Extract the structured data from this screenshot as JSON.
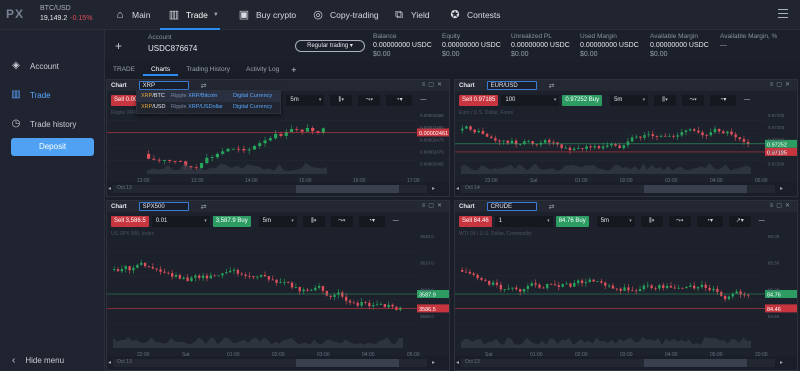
{
  "brand": {
    "logo": "PX"
  },
  "ticker": {
    "pair": "BTC/USD",
    "price": "19,149.2",
    "change": "-0.15%"
  },
  "nav": {
    "main": "Main",
    "trade": "Trade",
    "buy_crypto": "Buy crypto",
    "copy_trading": "Copy-trading",
    "yield": "Yield",
    "contests": "Contests"
  },
  "sidebar": {
    "account": "Account",
    "trade": "Trade",
    "trade_history": "Trade history",
    "deposit": "Deposit",
    "hide_menu": "Hide menu"
  },
  "account": {
    "label": "Account",
    "id": "USDC876674",
    "mode": "Regular trading",
    "balance_label": "Balance",
    "balance": "0.00000000 USDC",
    "balance_usd": "$0.00",
    "equity_label": "Equity",
    "equity": "0.00000000 USDC",
    "equity_usd": "$0.00",
    "upl_label": "Unrealized PL",
    "upl": "0.00000000 USDC",
    "upl_usd": "$0.00",
    "used_margin_label": "Used Margin",
    "used_margin": "0.00000000 USDC",
    "used_margin_usd": "$0.00",
    "avail_margin_label": "Available Margin",
    "avail_margin": "0.00000000 USDC",
    "avail_margin_usd": "$0.00",
    "avail_margin_pct_label": "Available Margin, %",
    "avail_margin_pct": "—"
  },
  "tabs": [
    "TRADE",
    "Charts",
    "Trading History",
    "Activity Log"
  ],
  "panels": [
    {
      "title": "Chart",
      "symbol": "XRP",
      "sell": "Sell 0.00",
      "qty": "",
      "buy": "",
      "timeframe": "5m",
      "watermark": "Ripple XRP/Bitcoin, Digital Currency",
      "price_tags": [
        "0.00002461"
      ],
      "tag_colors": [
        "#c7363f"
      ],
      "y_ticks": [
        "0.00002485",
        "0.00002480",
        "0.00002475",
        "0.00002470",
        "0.00002465"
      ],
      "x_ticks": [
        "13:00",
        "13:30",
        "14:00",
        "15:00",
        "16:00",
        "17:00"
      ],
      "date": "Oct 13"
    },
    {
      "title": "Chart",
      "symbol": "EUR/USD",
      "sell": "Sell 0.97185",
      "qty": "100",
      "buy": "0.97252 Buy",
      "timeframe": "5m",
      "watermark": "Euro / U.S. Dollar, Forex",
      "price_tags": [
        "0.97252",
        "0.97185"
      ],
      "tag_colors": [
        "#2c9c63",
        "#c7363f"
      ],
      "y_ticks": [
        "0.97400",
        "0.97350",
        "0.97300",
        "0.97250",
        "0.97200"
      ],
      "x_ticks": [
        "22:00",
        "Sat",
        "01:00",
        "02:00",
        "03:00",
        "04:00",
        "05:00"
      ],
      "date": "Oct 14"
    },
    {
      "title": "Chart",
      "symbol": "SPX500",
      "sell": "Sell 3,586.5",
      "qty": "0.01",
      "buy": "3,587.9 Buy",
      "timeframe": "5m",
      "watermark": "US SPX 500, Index",
      "price_tags": [
        "3587.9",
        "3586.5"
      ],
      "tag_colors": [
        "#2c9c63",
        "#c7363f"
      ],
      "y_ticks": [
        "3620.0",
        "3610.0",
        "3600.0",
        "3590.0"
      ],
      "x_ticks": [
        "22:00",
        "Sat",
        "01:00",
        "02:00",
        "03:00",
        "04:00",
        "05:00"
      ],
      "date": "Oct 13"
    },
    {
      "title": "Chart",
      "symbol": "CRUDE",
      "sell": "Sell 84.46",
      "qty": "1",
      "buy": "84.76 Buy",
      "timeframe": "5m",
      "watermark": "WTI Oil / U.S. Dollar, Commodity",
      "price_tags": [
        "84.76",
        "84.46"
      ],
      "tag_colors": [
        "#2c9c63",
        "#c7363f"
      ],
      "y_ticks": [
        "86.00",
        "85.50",
        "85.00",
        "84.50"
      ],
      "x_ticks": [
        "Sat",
        "01:00",
        "02:00",
        "03:00",
        "04:00",
        "05:00",
        "20:00"
      ],
      "date": "Oct 13"
    }
  ],
  "dropdown": [
    {
      "sym_a": "XRP",
      "sym_b": "/BTC",
      "name_a": "Ripple ",
      "name_b": "XRP/Bitcoin",
      "cat": "Digital Currency"
    },
    {
      "sym_a": "XRP",
      "sym_b": "/USD",
      "name_a": "Ripple ",
      "name_b": "XRP/USDollar",
      "cat": "Digital Currency"
    }
  ]
}
